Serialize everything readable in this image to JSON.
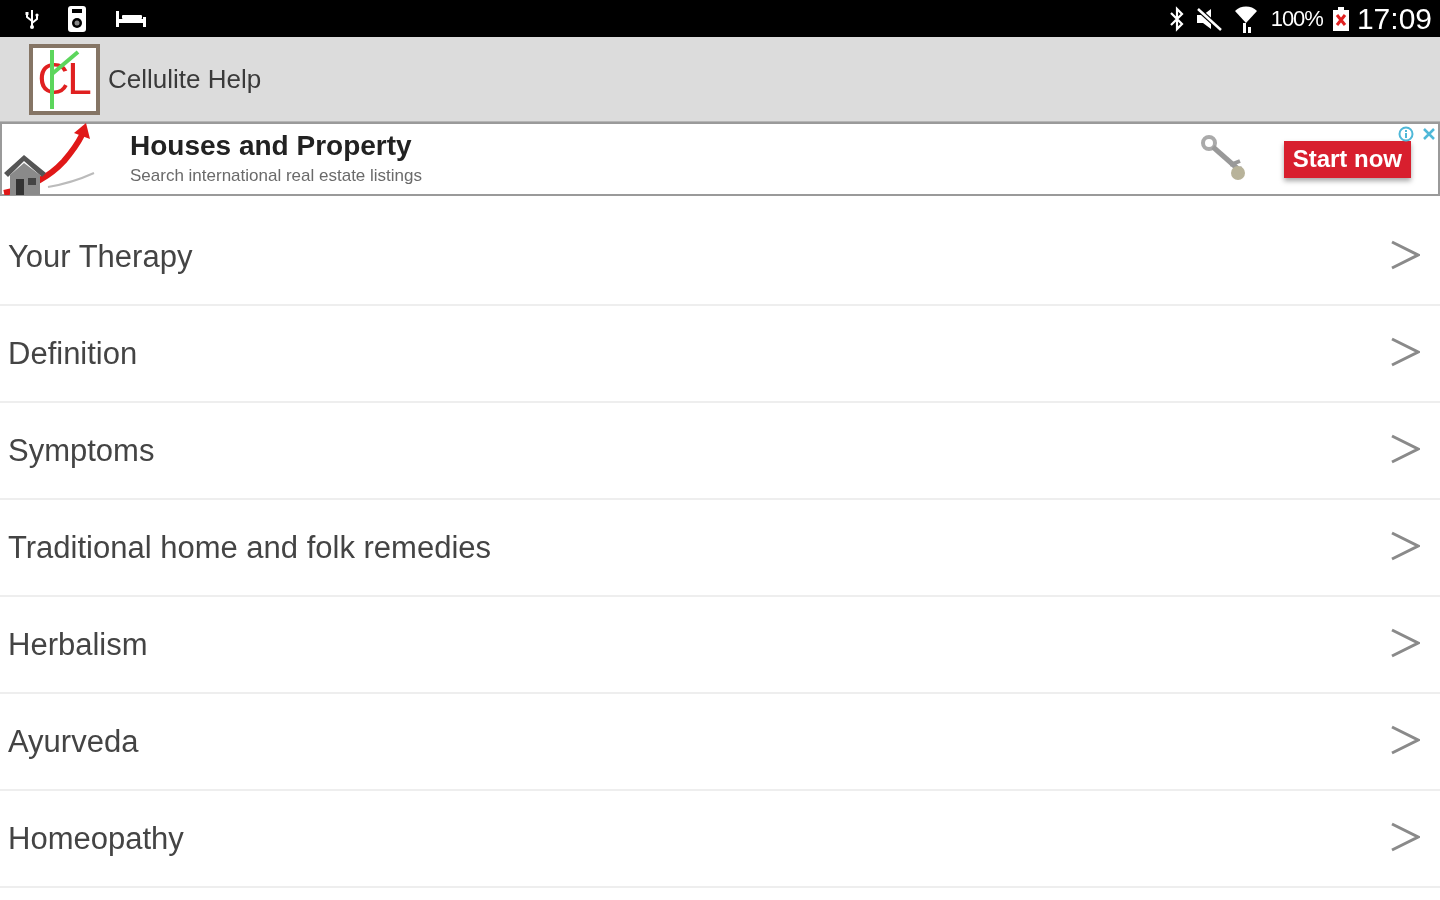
{
  "status_bar": {
    "battery_text": "100%",
    "time": "17:09"
  },
  "app_bar": {
    "logo_text": "CL",
    "title": "Cellulite Help"
  },
  "ad": {
    "title": "Houses and Property",
    "subtitle": "Search international real estate listings",
    "button": "Start now"
  },
  "menu": {
    "items": [
      {
        "label": "Your Therapy"
      },
      {
        "label": "Definition"
      },
      {
        "label": "Symptoms"
      },
      {
        "label": "Traditional home and folk remedies"
      },
      {
        "label": "Herbalism"
      },
      {
        "label": "Ayurveda"
      },
      {
        "label": "Homeopathy"
      }
    ]
  }
}
